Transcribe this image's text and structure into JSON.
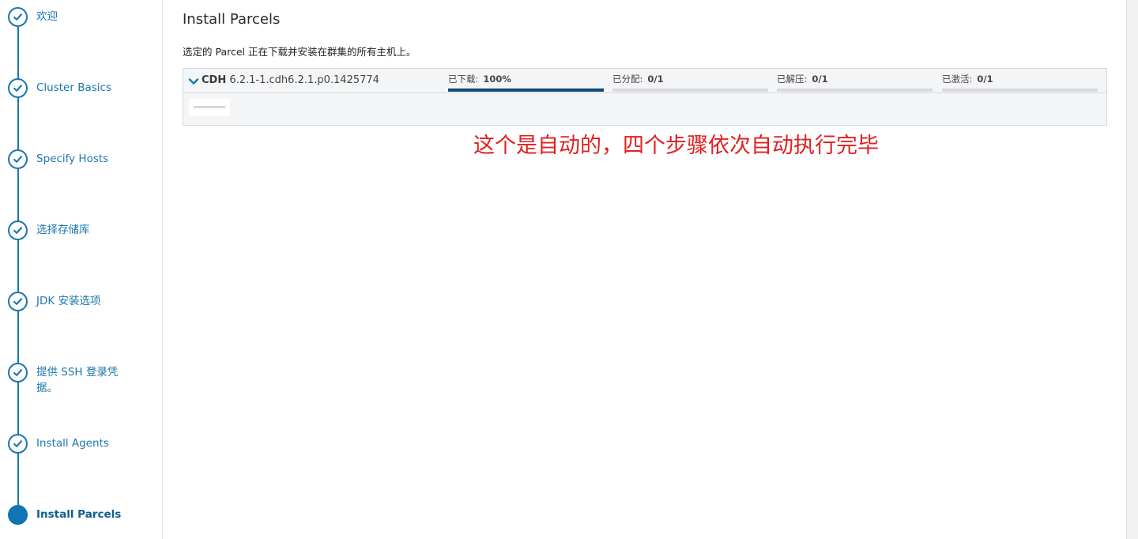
{
  "sidebar": {
    "steps": [
      {
        "label": "欢迎",
        "status": "done"
      },
      {
        "label": "Cluster Basics",
        "status": "done"
      },
      {
        "label": "Specify Hosts",
        "status": "done"
      },
      {
        "label": "选择存储库",
        "status": "done"
      },
      {
        "label": "JDK 安装选项",
        "status": "done"
      },
      {
        "label": "提供 SSH 登录凭据。",
        "status": "done"
      },
      {
        "label": "Install Agents",
        "status": "done"
      },
      {
        "label": "Install Parcels",
        "status": "current"
      }
    ]
  },
  "main": {
    "title": "Install Parcels",
    "description": "选定的 Parcel 正在下载并安装在群集的所有主机上。",
    "parcel": {
      "name": "CDH",
      "version": "6.2.1-1.cdh6.2.1.p0.1425774",
      "stages": [
        {
          "label": "已下载:",
          "value": "100%",
          "progress": 1.0
        },
        {
          "label": "已分配:",
          "value": "0/1",
          "progress": 0.0
        },
        {
          "label": "已解压:",
          "value": "0/1",
          "progress": 0.0
        },
        {
          "label": "已激活:",
          "value": "0/1",
          "progress": 0.0
        }
      ]
    }
  },
  "annotation": "这个是自动的，四个步骤依次自动执行完毕",
  "colors": {
    "accent": "#1b77ad",
    "progress_fill": "#0b4a7a",
    "annotation": "#e02020"
  }
}
